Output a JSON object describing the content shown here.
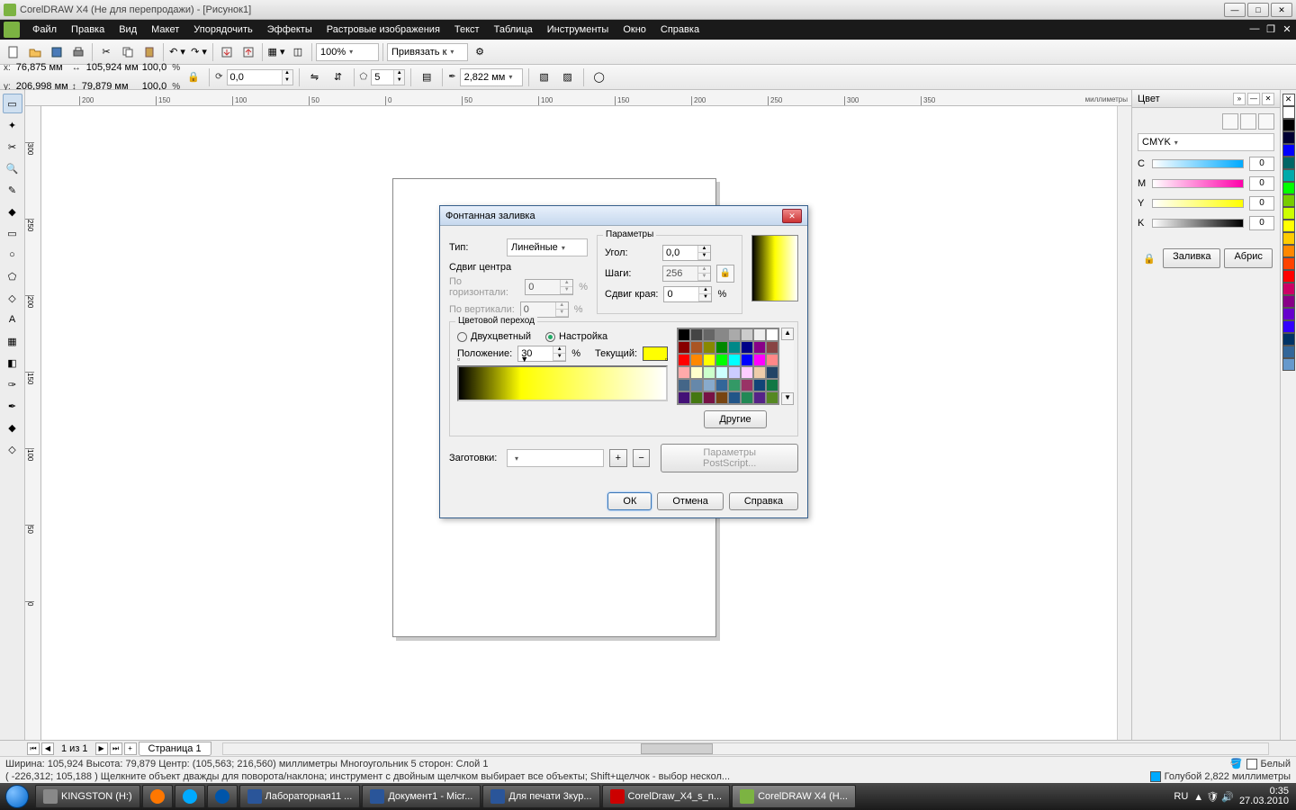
{
  "title": "CorelDRAW X4 (Не для перепродажи) - [Рисунок1]",
  "menu": [
    "Файл",
    "Правка",
    "Вид",
    "Макет",
    "Упорядочить",
    "Эффекты",
    "Растровые изображения",
    "Текст",
    "Таблица",
    "Инструменты",
    "Окно",
    "Справка"
  ],
  "toolbar1": {
    "zoom": "100%",
    "snap": "Привязать к"
  },
  "propbar": {
    "x": "76,875 мм",
    "y": "206,998 мм",
    "w": "105,924 мм",
    "h": "79,879 мм",
    "sx": "100,0",
    "sy": "100,0",
    "angle": "0,0",
    "sides": "5",
    "outline": "2,822 мм"
  },
  "ruler_end": "миллиметры",
  "pages": {
    "label": "1 из 1",
    "tab": "Страница 1"
  },
  "status1": {
    "left": "Ширина: 105,924  Высота: 79,879  Центр: (105,563; 216,560)  миллиметры       Многоугольник  5 сторон: Слой 1",
    "r1": "Белый",
    "r2": "Голубой  2,822 миллиметры"
  },
  "status2": "( -226,312; 105,188 )     Щелкните объект дважды для поворота/наклона; инструмент с двойным щелчком выбирает все объекты; Shift+щелчок - выбор нескол...",
  "colorpanel": {
    "title": "Цвет",
    "model": "CMYK",
    "c": "0",
    "m": "0",
    "y": "0",
    "k": "0",
    "fill": "Заливка",
    "outline": "Абрис"
  },
  "dialog": {
    "title": "Фонтанная заливка",
    "type_lbl": "Тип:",
    "type_val": "Линейные",
    "offset_lbl": "Сдвиг центра",
    "off_h": "По горизонтали:",
    "off_v": "По вертикали:",
    "off_h_val": "0",
    "off_v_val": "0",
    "params": "Параметры",
    "angle_lbl": "Угол:",
    "angle_val": "0,0",
    "steps_lbl": "Шаги:",
    "steps_val": "256",
    "edge_lbl": "Сдвиг края:",
    "edge_val": "0",
    "blend": "Цветовой переход",
    "two": "Двухцветный",
    "custom": "Настройка",
    "pos_lbl": "Положение:",
    "pos_val": "30",
    "cur_lbl": "Текущий:",
    "other": "Другие",
    "presets_lbl": "Заготовки:",
    "ps": "Параметры PostScript...",
    "ok": "ОК",
    "cancel": "Отмена",
    "help": "Справка"
  },
  "taskbar": {
    "items": [
      "KINGSTON (H:)",
      "",
      "",
      "",
      "Лабораторная11 ...",
      "Документ1 - Micr...",
      "Для печати 3кур...",
      "CorelDraw_X4_s_n...",
      "CorelDRAW X4 (Н..."
    ],
    "lang": "RU",
    "time": "0:35",
    "date": "27.03.2010"
  },
  "palette_colors": [
    "#000",
    "#444",
    "#666",
    "#888",
    "#aaa",
    "#ccc",
    "#eee",
    "#fff",
    "#800",
    "#a52",
    "#880",
    "#080",
    "#088",
    "#008",
    "#808",
    "#844",
    "#f00",
    "#f80",
    "#ff0",
    "#0f0",
    "#0ff",
    "#00f",
    "#f0f",
    "#f88",
    "#faa",
    "#ffc",
    "#cfc",
    "#cff",
    "#ccf",
    "#fcf",
    "#eca",
    "#246",
    "#468",
    "#68a",
    "#8ac",
    "#369",
    "#396",
    "#936",
    "#147",
    "#174",
    "#417",
    "#471",
    "#714",
    "#741",
    "#258",
    "#285",
    "#528",
    "#582",
    "#825",
    "#852",
    "#39c",
    "#3c9"
  ],
  "strip_colors": [
    "#fff",
    "#000",
    "#003",
    "#00f",
    "#066",
    "#0aa",
    "#0f0",
    "#7c0",
    "#cf0",
    "#ff0",
    "#fc0",
    "#f80",
    "#f40",
    "#f00",
    "#c06",
    "#808",
    "#60c",
    "#30f",
    "#036",
    "#369",
    "#69c"
  ]
}
